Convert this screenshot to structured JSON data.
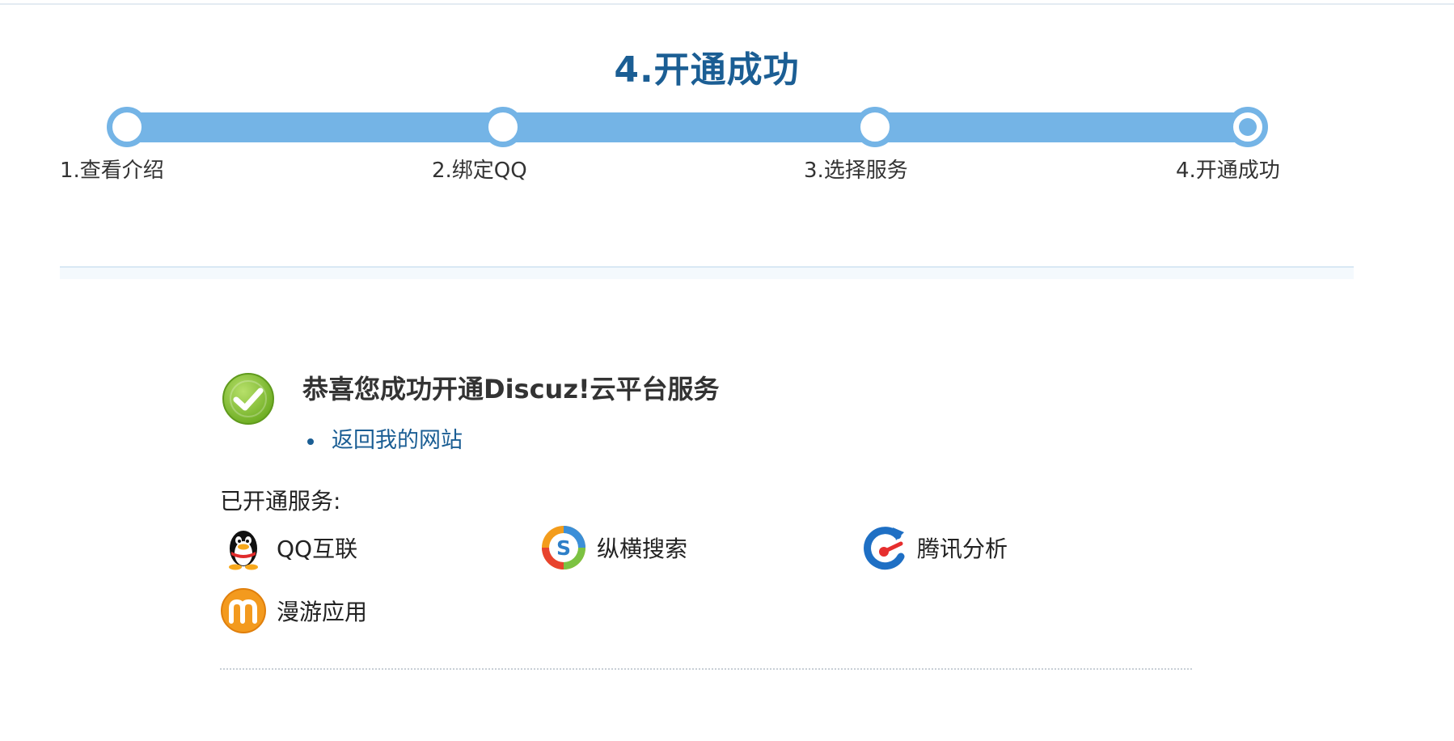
{
  "wizard": {
    "current_step_title": "4.开通成功",
    "steps": [
      {
        "label": "1.查看介绍"
      },
      {
        "label": "2.绑定QQ"
      },
      {
        "label": "3.选择服务"
      },
      {
        "label": "4.开通成功"
      }
    ]
  },
  "success": {
    "title": "恭喜您成功开通Discuz!云平台服务",
    "back_link": "返回我的网站"
  },
  "services": {
    "heading": "已开通服务:",
    "items": [
      {
        "name": "QQ互联",
        "icon": "qq-penguin-icon"
      },
      {
        "name": "纵横搜索",
        "icon": "search-s-icon"
      },
      {
        "name": "腾讯分析",
        "icon": "tencent-analytics-icon"
      },
      {
        "name": "漫游应用",
        "icon": "manyou-icon"
      }
    ]
  },
  "colors": {
    "accent": "#74b4e6",
    "title_blue": "#1b5e94",
    "success_green": "#8cc63e"
  }
}
